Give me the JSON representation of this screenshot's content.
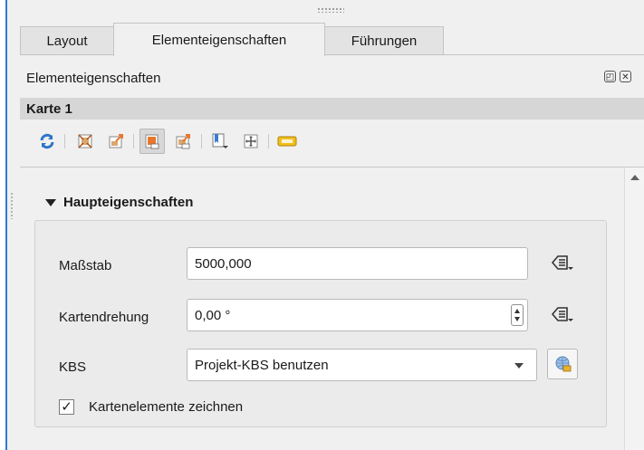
{
  "tabs": [
    "Layout",
    "Elementeigenschaften",
    "Führungen"
  ],
  "active_tab": 1,
  "dock_title": "Elementeigenschaften",
  "item_title": "Karte 1",
  "toolbar_icons": [
    "refresh-icon",
    "set-extent-icon",
    "view-extent-icon",
    "atlas-extent-icon",
    "atlas-view-icon",
    "bookmark-icon",
    "move-content-icon",
    "label-settings-icon"
  ],
  "section_title": "Haupteigenschaften",
  "fields": {
    "scale_label": "Maßstab",
    "scale_value": "5000,000",
    "rotation_label": "Kartendrehung",
    "rotation_value": "0,00 °",
    "crs_label": "KBS",
    "crs_value": "Projekt-KBS benutzen",
    "draw_items_label": "Kartenelemente zeichnen",
    "draw_items_checked": true,
    "check_mark": "✓"
  },
  "colors": {
    "accent": "#2e7ad6",
    "icon_orange": "#e8772e"
  }
}
